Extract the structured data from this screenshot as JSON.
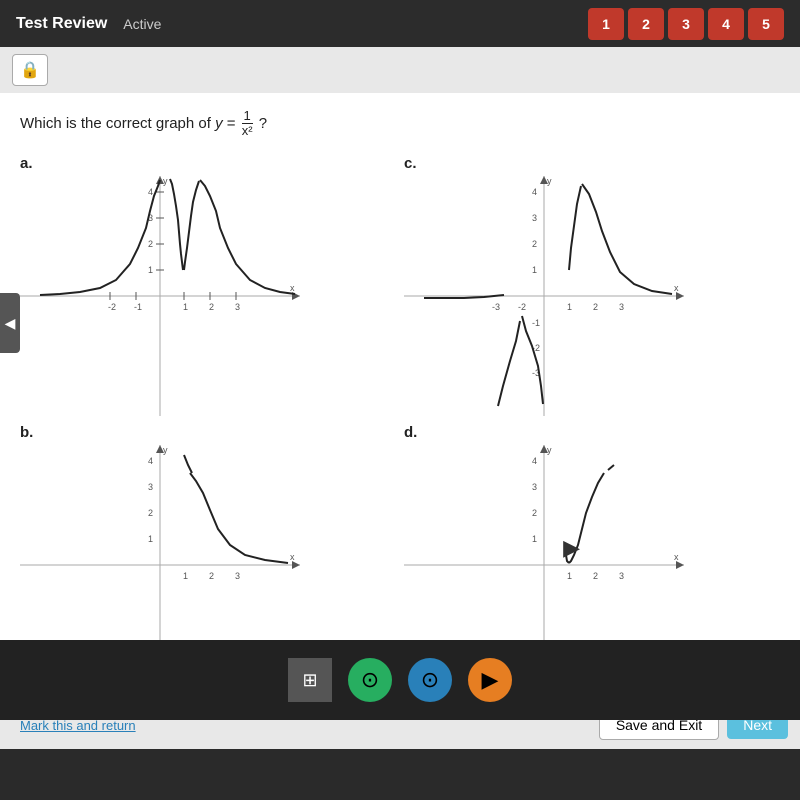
{
  "header": {
    "title": "Test Review",
    "status": "Active",
    "nav_buttons": [
      "1",
      "2",
      "3",
      "4",
      "5"
    ]
  },
  "toolbar": {
    "lock_icon": "🔒"
  },
  "question": {
    "text": "Which is the correct graph of",
    "formula_numerator": "1",
    "formula_denominator": "x²",
    "question_mark": "?"
  },
  "graphs": [
    {
      "label": "a.",
      "type": "1/x2_symmetric_positive",
      "x_range": [
        -5,
        5
      ],
      "y_range": [
        -5,
        5
      ]
    },
    {
      "label": "c.",
      "type": "1/x2_right_only",
      "x_range": [
        -5,
        5
      ],
      "y_range": [
        -5,
        5
      ]
    },
    {
      "label": "b.",
      "type": "partial_upper",
      "x_range": [
        -5,
        5
      ],
      "y_range": [
        0,
        5
      ]
    },
    {
      "label": "d.",
      "type": "partial_upper_right",
      "x_range": [
        -5,
        5
      ],
      "y_range": [
        0,
        5
      ]
    }
  ],
  "bottom_bar": {
    "mark_link": "Mark this and return",
    "save_button": "Save and Exit",
    "next_button": "Next"
  },
  "taskbar": {
    "icons": [
      "square",
      "circle_green",
      "circle_blue",
      "circle_orange"
    ]
  }
}
